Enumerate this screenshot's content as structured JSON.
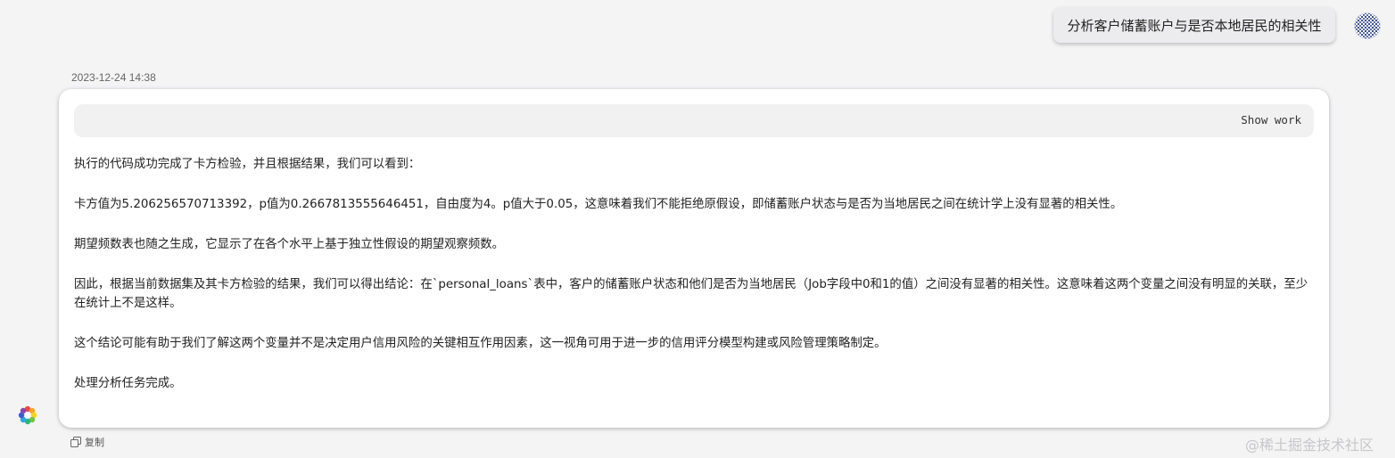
{
  "user_message": {
    "text": "分析客户储蓄账户与是否本地居民的相关性",
    "avatar_icon": "user-avatar-icon"
  },
  "response": {
    "timestamp": "2023-12-24 14:38",
    "show_work_label": "Show work",
    "paragraphs": [
      "执行的代码成功完成了卡方检验，并且根据结果，我们可以看到：",
      "卡方值为5.206256570713392，p值为0.2667813555646451，自由度为4。p值大于0.05，这意味着我们不能拒绝原假设，即储蓄账户状态与是否为当地居民之间在统计学上没有显著的相关性。",
      "期望频数表也随之生成，它显示了在各个水平上基于独立性假设的期望观察频数。",
      "因此，根据当前数据集及其卡方检验的结果，我们可以得出结论：在`personal_loans`表中，客户的储蓄账户状态和他们是否为当地居民（Job字段中0和1的值）之间没有显著的相关性。这意味着这两个变量之间没有明显的关联，至少在统计上不是这样。",
      "这个结论可能有助于我们了解这两个变量并不是决定用户信用风险的关键相互作用因素，这一视角可用于进一步的信用评分模型构建或风险管理策略制定。",
      "处理分析任务完成。"
    ],
    "copy_label": "复制",
    "copy_icon": "copy-icon",
    "assistant_icon": "assistant-logo-icon"
  },
  "watermark": "@稀土掘金技术社区"
}
